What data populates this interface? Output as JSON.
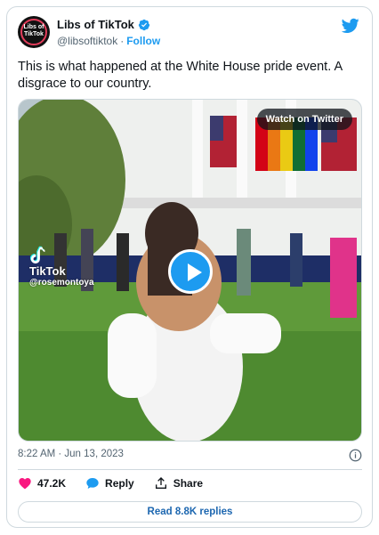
{
  "author": {
    "display_name": "Libs of TikTok",
    "handle": "@libsoftiktok",
    "separator": "·",
    "follow_label": "Follow",
    "avatar_text_line1": "Libs of",
    "avatar_text_line2": "TikTok",
    "verified_icon": "verified-badge-icon"
  },
  "tweet": {
    "text": "This is what happened at the White House pride event. A disgrace to our country.",
    "timestamp": "8:22 AM · Jun 13, 2023"
  },
  "media": {
    "watch_label": "Watch on Twitter",
    "tiktok_brand": "TikTok",
    "tiktok_user": "@rosemontoya",
    "play_icon": "play-icon"
  },
  "actions": {
    "likes": "47.2K",
    "reply_label": "Reply",
    "share_label": "Share"
  },
  "replies_button": "Read 8.8K replies",
  "colors": {
    "accent": "#1d9bf0",
    "like": "#f91880",
    "link": "#1d67b0"
  }
}
